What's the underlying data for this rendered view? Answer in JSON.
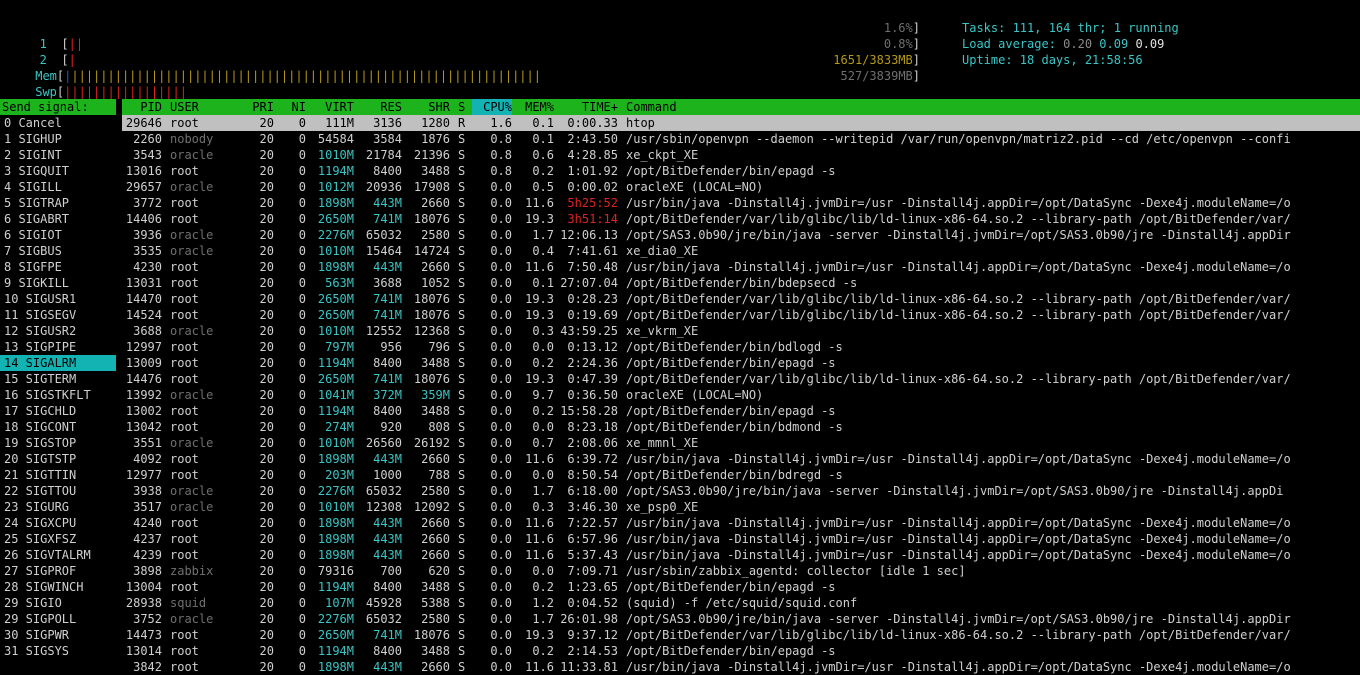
{
  "meters": {
    "cpu1": {
      "label": "1",
      "value": "1.6%",
      "fill": 0.016
    },
    "cpu2": {
      "label": "2",
      "value": "0.8%",
      "fill": 0.008
    },
    "mem": {
      "label": "Mem",
      "value": "1651/3833MB",
      "fill": 0.43
    },
    "swp": {
      "label": "Swp",
      "value": "527/3839MB",
      "fill": 0.14
    }
  },
  "info": {
    "tasks_label": "Tasks: ",
    "tasks_value": "111, 164 thr; 1 running",
    "load_label": "Load average: ",
    "load_1": "0.20",
    "load_5": "0.09",
    "load_15": "0.09",
    "uptime_label": "Uptime: ",
    "uptime_value": "18 days, 21:58:56"
  },
  "signals": {
    "header": "Send signal:",
    "selected_index": 15,
    "items": [
      "0 Cancel",
      "1 SIGHUP",
      "2 SIGINT",
      "3 SIGQUIT",
      "4 SIGILL",
      "5 SIGTRAP",
      "6 SIGABRT",
      "6 SIGIOT",
      "7 SIGBUS",
      "8 SIGFPE",
      "9 SIGKILL",
      "10 SIGUSR1",
      "11 SIGSEGV",
      "12 SIGUSR2",
      "13 SIGPIPE",
      "14 SIGALRM",
      "15 SIGTERM",
      "16 SIGSTKFLT",
      "17 SIGCHLD",
      "18 SIGCONT",
      "19 SIGSTOP",
      "20 SIGTSTP",
      "21 SIGTTIN",
      "22 SIGTTOU",
      "23 SIGURG",
      "24 SIGXCPU",
      "25 SIGXFSZ",
      "26 SIGVTALRM",
      "27 SIGPROF",
      "28 SIGWINCH",
      "29 SIGIO",
      "29 SIGPOLL",
      "30 SIGPWR",
      "31 SIGSYS"
    ]
  },
  "table": {
    "columns": {
      "pid": "PID",
      "user": "USER",
      "pri": "PRI",
      "ni": "NI",
      "virt": "VIRT",
      "res": "RES",
      "shr": "SHR",
      "s": "S",
      "cpu": "CPU%",
      "mem": "MEM%",
      "time": "TIME+",
      "cmd": "Command"
    },
    "rows": [
      [
        "29646",
        "root",
        "20",
        "0",
        "111M",
        "3136",
        "1280",
        "R",
        "1.6",
        "0.1",
        "0:00.33",
        "htop"
      ],
      [
        "2260",
        "nobody",
        "20",
        "0",
        "54584",
        "3584",
        "1876",
        "S",
        "0.8",
        "0.1",
        "2:43.50",
        "/usr/sbin/openvpn --daemon --writepid /var/run/openvpn/matriz2.pid --cd /etc/openvpn --confi"
      ],
      [
        "3543",
        "oracle",
        "20",
        "0",
        "1010M",
        "21784",
        "21396",
        "S",
        "0.8",
        "0.6",
        "4:28.85",
        "xe_ckpt_XE"
      ],
      [
        "13016",
        "root",
        "20",
        "0",
        "1194M",
        "8400",
        "3488",
        "S",
        "0.8",
        "0.2",
        "1:01.92",
        "/opt/BitDefender/bin/epagd -s"
      ],
      [
        "29657",
        "oracle",
        "20",
        "0",
        "1012M",
        "20936",
        "17908",
        "S",
        "0.0",
        "0.5",
        "0:00.02",
        "oracleXE (LOCAL=NO)"
      ],
      [
        "3772",
        "root",
        "20",
        "0",
        "1898M",
        "443M",
        "2660",
        "S",
        "0.0",
        "11.6",
        "5h25:52",
        "/usr/bin/java -Dinstall4j.jvmDir=/usr -Dinstall4j.appDir=/opt/DataSync -Dexe4j.moduleName=/o"
      ],
      [
        "14406",
        "root",
        "20",
        "0",
        "2650M",
        "741M",
        "18076",
        "S",
        "0.0",
        "19.3",
        "3h51:14",
        "/opt/BitDefender/var/lib/glibc/lib/ld-linux-x86-64.so.2 --library-path /opt/BitDefender/var/"
      ],
      [
        "3936",
        "oracle",
        "20",
        "0",
        "2276M",
        "65032",
        "2580",
        "S",
        "0.0",
        "1.7",
        "12:06.13",
        "/opt/SAS3.0b90/jre/bin/java -server -Dinstall4j.jvmDir=/opt/SAS3.0b90/jre -Dinstall4j.appDir"
      ],
      [
        "3535",
        "oracle",
        "20",
        "0",
        "1010M",
        "15464",
        "14724",
        "S",
        "0.0",
        "0.4",
        "7:41.61",
        "xe_dia0_XE"
      ],
      [
        "4230",
        "root",
        "20",
        "0",
        "1898M",
        "443M",
        "2660",
        "S",
        "0.0",
        "11.6",
        "7:50.48",
        "/usr/bin/java -Dinstall4j.jvmDir=/usr -Dinstall4j.appDir=/opt/DataSync -Dexe4j.moduleName=/o"
      ],
      [
        "13031",
        "root",
        "20",
        "0",
        "563M",
        "3688",
        "1052",
        "S",
        "0.0",
        "0.1",
        "27:07.04",
        "/opt/BitDefender/bin/bdepsecd -s"
      ],
      [
        "14470",
        "root",
        "20",
        "0",
        "2650M",
        "741M",
        "18076",
        "S",
        "0.0",
        "19.3",
        "0:28.23",
        "/opt/BitDefender/var/lib/glibc/lib/ld-linux-x86-64.so.2 --library-path /opt/BitDefender/var/"
      ],
      [
        "14524",
        "root",
        "20",
        "0",
        "2650M",
        "741M",
        "18076",
        "S",
        "0.0",
        "19.3",
        "0:19.69",
        "/opt/BitDefender/var/lib/glibc/lib/ld-linux-x86-64.so.2 --library-path /opt/BitDefender/var/"
      ],
      [
        "3688",
        "oracle",
        "20",
        "0",
        "1010M",
        "12552",
        "12368",
        "S",
        "0.0",
        "0.3",
        "43:59.25",
        "xe_vkrm_XE"
      ],
      [
        "12997",
        "root",
        "20",
        "0",
        "797M",
        "956",
        "796",
        "S",
        "0.0",
        "0.0",
        "0:13.12",
        "/opt/BitDefender/bin/bdlogd -s"
      ],
      [
        "13009",
        "root",
        "20",
        "0",
        "1194M",
        "8400",
        "3488",
        "S",
        "0.0",
        "0.2",
        "2:24.36",
        "/opt/BitDefender/bin/epagd -s"
      ],
      [
        "14476",
        "root",
        "20",
        "0",
        "2650M",
        "741M",
        "18076",
        "S",
        "0.0",
        "19.3",
        "0:47.39",
        "/opt/BitDefender/var/lib/glibc/lib/ld-linux-x86-64.so.2 --library-path /opt/BitDefender/var/"
      ],
      [
        "13992",
        "oracle",
        "20",
        "0",
        "1041M",
        "372M",
        "359M",
        "S",
        "0.0",
        "9.7",
        "0:36.50",
        "oracleXE (LOCAL=NO)"
      ],
      [
        "13002",
        "root",
        "20",
        "0",
        "1194M",
        "8400",
        "3488",
        "S",
        "0.0",
        "0.2",
        "15:58.28",
        "/opt/BitDefender/bin/epagd -s"
      ],
      [
        "13042",
        "root",
        "20",
        "0",
        "274M",
        "920",
        "808",
        "S",
        "0.0",
        "0.0",
        "8:23.18",
        "/opt/BitDefender/bin/bdmond -s"
      ],
      [
        "3551",
        "oracle",
        "20",
        "0",
        "1010M",
        "26560",
        "26192",
        "S",
        "0.0",
        "0.7",
        "2:08.06",
        "xe_mmnl_XE"
      ],
      [
        "4092",
        "root",
        "20",
        "0",
        "1898M",
        "443M",
        "2660",
        "S",
        "0.0",
        "11.6",
        "6:39.72",
        "/usr/bin/java -Dinstall4j.jvmDir=/usr -Dinstall4j.appDir=/opt/DataSync -Dexe4j.moduleName=/o"
      ],
      [
        "12977",
        "root",
        "20",
        "0",
        "203M",
        "1000",
        "788",
        "S",
        "0.0",
        "0.0",
        "8:50.54",
        "/opt/BitDefender/bin/bdregd -s"
      ],
      [
        "3938",
        "oracle",
        "20",
        "0",
        "2276M",
        "65032",
        "2580",
        "S",
        "0.0",
        "1.7",
        "6:18.00",
        "/opt/SAS3.0b90/jre/bin/java -server -Dinstall4j.jvmDir=/opt/SAS3.0b90/jre -Dinstall4j.appDi"
      ],
      [
        "3517",
        "oracle",
        "20",
        "0",
        "1010M",
        "12308",
        "12092",
        "S",
        "0.0",
        "0.3",
        "3:46.30",
        "xe_psp0_XE"
      ],
      [
        "4240",
        "root",
        "20",
        "0",
        "1898M",
        "443M",
        "2660",
        "S",
        "0.0",
        "11.6",
        "7:22.57",
        "/usr/bin/java -Dinstall4j.jvmDir=/usr -Dinstall4j.appDir=/opt/DataSync -Dexe4j.moduleName=/o"
      ],
      [
        "4237",
        "root",
        "20",
        "0",
        "1898M",
        "443M",
        "2660",
        "S",
        "0.0",
        "11.6",
        "6:57.96",
        "/usr/bin/java -Dinstall4j.jvmDir=/usr -Dinstall4j.appDir=/opt/DataSync -Dexe4j.moduleName=/o"
      ],
      [
        "4239",
        "root",
        "20",
        "0",
        "1898M",
        "443M",
        "2660",
        "S",
        "0.0",
        "11.6",
        "5:37.43",
        "/usr/bin/java -Dinstall4j.jvmDir=/usr -Dinstall4j.appDir=/opt/DataSync -Dexe4j.moduleName=/o"
      ],
      [
        "3898",
        "zabbix",
        "20",
        "0",
        "79316",
        "700",
        "620",
        "S",
        "0.0",
        "0.0",
        "7:09.71",
        "/usr/sbin/zabbix_agentd: collector [idle 1 sec]"
      ],
      [
        "13004",
        "root",
        "20",
        "0",
        "1194M",
        "8400",
        "3488",
        "S",
        "0.0",
        "0.2",
        "1:23.65",
        "/opt/BitDefender/bin/epagd -s"
      ],
      [
        "28938",
        "squid",
        "20",
        "0",
        "107M",
        "45928",
        "5388",
        "S",
        "0.0",
        "1.2",
        "0:04.52",
        "(squid) -f /etc/squid/squid.conf"
      ],
      [
        "3752",
        "oracle",
        "20",
        "0",
        "2276M",
        "65032",
        "2580",
        "S",
        "0.0",
        "1.7",
        "26:01.98",
        "/opt/SAS3.0b90/jre/bin/java -server -Dinstall4j.jvmDir=/opt/SAS3.0b90/jre -Dinstall4j.appDir"
      ],
      [
        "14473",
        "root",
        "20",
        "0",
        "2650M",
        "741M",
        "18076",
        "S",
        "0.0",
        "19.3",
        "9:37.12",
        "/opt/BitDefender/var/lib/glibc/lib/ld-linux-x86-64.so.2 --library-path /opt/BitDefender/var/"
      ],
      [
        "13014",
        "root",
        "20",
        "0",
        "1194M",
        "8400",
        "3488",
        "S",
        "0.0",
        "0.2",
        "2:14.53",
        "/opt/BitDefender/bin/epagd -s"
      ],
      [
        "3842",
        "root",
        "20",
        "0",
        "1898M",
        "443M",
        "2660",
        "S",
        "0.0",
        "11.6",
        "11:33.81",
        "/usr/bin/java -Dinstall4j.jvmDir=/usr -Dinstall4j.appDir=/opt/DataSync -Dexe4j.moduleName=/o"
      ]
    ]
  }
}
